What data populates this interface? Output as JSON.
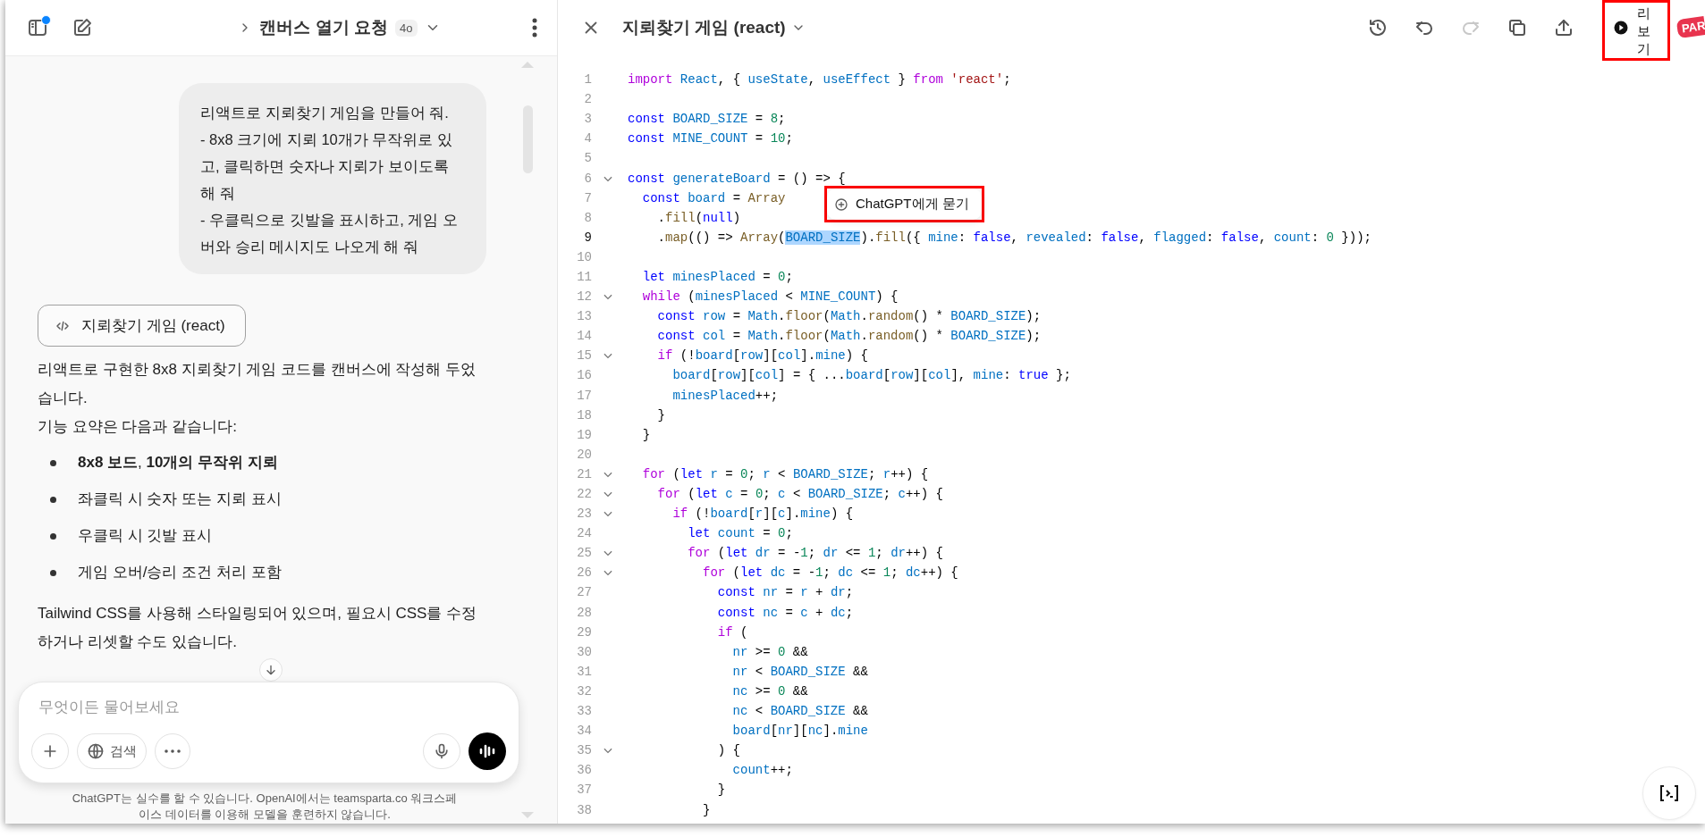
{
  "chat": {
    "header": {
      "title": "캔버스 열기 요청",
      "model": "4o",
      "unread": true
    },
    "user_message": "리액트로 지뢰찾기 게임을 만들어 줘.\n- 8x8 크기에 지뢰 10개가 무작위로 있고, 클릭하면 숫자나 지뢰가 보이도록 해 줘\n- 우클릭으로 깃발을 표시하고, 게임 오버와 승리 메시지도 나오게 해 줘",
    "canvas_chip": "지뢰찾기 게임 (react)",
    "intro": [
      "리액트로 구현한 8x8 지뢰찾기 게임 코드를 캔버스에 작성해 두었습니다.",
      "기능 요약은 다음과 같습니다:"
    ],
    "bullets": [
      "**8x8 보드**, **10개의 무작위 지뢰**",
      "좌클릭 시 숫자 또는 지뢰 표시",
      "우클릭 시 깃발 표시",
      "게임 오버/승리 조건 처리 포함"
    ],
    "outro": "Tailwind CSS를 사용해 스타일링되어 있으며, 필요시 CSS를 수정하거나 리셋할 수도 있습니다.",
    "composer": {
      "placeholder": "무엇이든 물어보세요",
      "search": "검색"
    },
    "disclaimer": "ChatGPT는 실수를 할 수 있습니다. OpenAI에서는 teamsparta.co 워크스페이스 데이터를 이용해 모델을 훈련하지 않습니다."
  },
  "canvas": {
    "title": "지뢰찾기 게임 (react)",
    "toolbar": [
      {
        "kind": "history",
        "disabled": false
      },
      {
        "kind": "undo",
        "disabled": false
      },
      {
        "kind": "redo",
        "disabled": true
      },
      {
        "kind": "copy",
        "disabled": false
      },
      {
        "kind": "share",
        "disabled": false
      }
    ],
    "preview": {
      "label": "리보기",
      "highlighted": true
    },
    "logo": "PAR",
    "ask_popup": {
      "label": "ChatGPT에게 묻기",
      "highlighted": true
    },
    "lines": [
      {
        "number": "1",
        "foldable": false,
        "current": false,
        "tokens": [
          {
            "kind": "ctl",
            "text": "import"
          },
          {
            "kind": "var",
            "text": " React"
          },
          {
            "kind": "p",
            "text": ", { "
          },
          {
            "kind": "var",
            "text": "useState"
          },
          {
            "kind": "p",
            "text": ", "
          },
          {
            "kind": "var",
            "text": "useEffect"
          },
          {
            "kind": "p",
            "text": " } "
          },
          {
            "kind": "ctl",
            "text": "from"
          },
          {
            "kind": "str",
            "text": " 'react'"
          },
          {
            "kind": "p",
            "text": ";"
          }
        ]
      },
      {
        "number": "2",
        "foldable": false,
        "current": false
      },
      {
        "number": "3",
        "foldable": false,
        "current": false,
        "tokens": [
          {
            "kind": "kw",
            "text": "const"
          },
          {
            "kind": "var",
            "text": " BOARD_SIZE"
          },
          {
            "kind": "p",
            "text": " = "
          },
          {
            "kind": "num",
            "text": "8"
          },
          {
            "kind": "p",
            "text": ";"
          }
        ]
      },
      {
        "number": "4",
        "foldable": false,
        "current": false,
        "tokens": [
          {
            "kind": "kw",
            "text": "const"
          },
          {
            "kind": "var",
            "text": " MINE_COUNT"
          },
          {
            "kind": "p",
            "text": " = "
          },
          {
            "kind": "num",
            "text": "10"
          },
          {
            "kind": "p",
            "text": ";"
          }
        ]
      },
      {
        "number": "5",
        "foldable": false,
        "current": false
      },
      {
        "number": "6",
        "foldable": true,
        "current": false,
        "tokens": [
          {
            "kind": "kw",
            "text": "const"
          },
          {
            "kind": "var",
            "text": " generateBoard"
          },
          {
            "kind": "p",
            "text": " = () => {"
          }
        ]
      },
      {
        "number": "7",
        "foldable": false,
        "current": false,
        "tokens": [
          {
            "kind": "kw",
            "text": "  const"
          },
          {
            "kind": "var",
            "text": " board"
          },
          {
            "kind": "p",
            "text": " = "
          },
          {
            "kind": "fn",
            "text": "Array"
          }
        ]
      },
      {
        "number": "8",
        "foldable": false,
        "current": false,
        "tokens": [
          {
            "kind": "p",
            "text": "    ."
          },
          {
            "kind": "fn",
            "text": "fill"
          },
          {
            "kind": "p",
            "text": "("
          },
          {
            "kind": "kw",
            "text": "null"
          },
          {
            "kind": "p",
            "text": ")"
          }
        ]
      },
      {
        "number": "9",
        "foldable": false,
        "current": true,
        "tokens": [
          {
            "kind": "p",
            "text": "    ."
          },
          {
            "kind": "fn",
            "text": "map"
          },
          {
            "kind": "p",
            "text": "(() => "
          },
          {
            "kind": "fn",
            "text": "Array"
          },
          {
            "kind": "p",
            "text": "("
          },
          {
            "kind": "sel",
            "text": "BOARD_SIZE"
          },
          {
            "kind": "p",
            "text": ")."
          },
          {
            "kind": "fn",
            "text": "fill"
          },
          {
            "kind": "p",
            "text": "({ "
          },
          {
            "kind": "var",
            "text": "mine"
          },
          {
            "kind": "p",
            "text": ": "
          },
          {
            "kind": "kw",
            "text": "false"
          },
          {
            "kind": "p",
            "text": ", "
          },
          {
            "kind": "var",
            "text": "revealed"
          },
          {
            "kind": "p",
            "text": ": "
          },
          {
            "kind": "kw",
            "text": "false"
          },
          {
            "kind": "p",
            "text": ", "
          },
          {
            "kind": "var",
            "text": "flagged"
          },
          {
            "kind": "p",
            "text": ": "
          },
          {
            "kind": "kw",
            "text": "false"
          },
          {
            "kind": "p",
            "text": ", "
          },
          {
            "kind": "var",
            "text": "count"
          },
          {
            "kind": "p",
            "text": ": "
          },
          {
            "kind": "num",
            "text": "0"
          },
          {
            "kind": "p",
            "text": " }));"
          }
        ]
      },
      {
        "number": "10",
        "foldable": false,
        "current": false
      },
      {
        "number": "11",
        "foldable": false,
        "current": false,
        "tokens": [
          {
            "kind": "kw",
            "text": "  let"
          },
          {
            "kind": "var",
            "text": " minesPlaced"
          },
          {
            "kind": "p",
            "text": " = "
          },
          {
            "kind": "num",
            "text": "0"
          },
          {
            "kind": "p",
            "text": ";"
          }
        ]
      },
      {
        "number": "12",
        "foldable": true,
        "current": false,
        "tokens": [
          {
            "kind": "ctl",
            "text": "  while"
          },
          {
            "kind": "p",
            "text": " ("
          },
          {
            "kind": "var",
            "text": "minesPlaced"
          },
          {
            "kind": "p",
            "text": " < "
          },
          {
            "kind": "var",
            "text": "MINE_COUNT"
          },
          {
            "kind": "p",
            "text": ") {"
          }
        ]
      },
      {
        "number": "13",
        "foldable": false,
        "current": false,
        "tokens": [
          {
            "kind": "kw",
            "text": "    const"
          },
          {
            "kind": "var",
            "text": " row"
          },
          {
            "kind": "p",
            "text": " = "
          },
          {
            "kind": "var",
            "text": "Math"
          },
          {
            "kind": "p",
            "text": "."
          },
          {
            "kind": "fn",
            "text": "floor"
          },
          {
            "kind": "p",
            "text": "("
          },
          {
            "kind": "var",
            "text": "Math"
          },
          {
            "kind": "p",
            "text": "."
          },
          {
            "kind": "fn",
            "text": "random"
          },
          {
            "kind": "p",
            "text": "() * "
          },
          {
            "kind": "var",
            "text": "BOARD_SIZE"
          },
          {
            "kind": "p",
            "text": ");"
          }
        ]
      },
      {
        "number": "14",
        "foldable": false,
        "current": false,
        "tokens": [
          {
            "kind": "kw",
            "text": "    const"
          },
          {
            "kind": "var",
            "text": " col"
          },
          {
            "kind": "p",
            "text": " = "
          },
          {
            "kind": "var",
            "text": "Math"
          },
          {
            "kind": "p",
            "text": "."
          },
          {
            "kind": "fn",
            "text": "floor"
          },
          {
            "kind": "p",
            "text": "("
          },
          {
            "kind": "var",
            "text": "Math"
          },
          {
            "kind": "p",
            "text": "."
          },
          {
            "kind": "fn",
            "text": "random"
          },
          {
            "kind": "p",
            "text": "() * "
          },
          {
            "kind": "var",
            "text": "BOARD_SIZE"
          },
          {
            "kind": "p",
            "text": ");"
          }
        ]
      },
      {
        "number": "15",
        "foldable": true,
        "current": false,
        "tokens": [
          {
            "kind": "ctl",
            "text": "    if"
          },
          {
            "kind": "p",
            "text": " (!"
          },
          {
            "kind": "var",
            "text": "board"
          },
          {
            "kind": "p",
            "text": "["
          },
          {
            "kind": "var",
            "text": "row"
          },
          {
            "kind": "p",
            "text": "]["
          },
          {
            "kind": "var",
            "text": "col"
          },
          {
            "kind": "p",
            "text": "]."
          },
          {
            "kind": "var",
            "text": "mine"
          },
          {
            "kind": "p",
            "text": ") {"
          }
        ]
      },
      {
        "number": "16",
        "foldable": false,
        "current": false,
        "tokens": [
          {
            "kind": "var",
            "text": "      board"
          },
          {
            "kind": "p",
            "text": "["
          },
          {
            "kind": "var",
            "text": "row"
          },
          {
            "kind": "p",
            "text": "]["
          },
          {
            "kind": "var",
            "text": "col"
          },
          {
            "kind": "p",
            "text": "] = { ..."
          },
          {
            "kind": "var",
            "text": "board"
          },
          {
            "kind": "p",
            "text": "["
          },
          {
            "kind": "var",
            "text": "row"
          },
          {
            "kind": "p",
            "text": "]["
          },
          {
            "kind": "var",
            "text": "col"
          },
          {
            "kind": "p",
            "text": "], "
          },
          {
            "kind": "var",
            "text": "mine"
          },
          {
            "kind": "p",
            "text": ": "
          },
          {
            "kind": "kw",
            "text": "true"
          },
          {
            "kind": "p",
            "text": " };"
          }
        ]
      },
      {
        "number": "17",
        "foldable": false,
        "current": false,
        "tokens": [
          {
            "kind": "var",
            "text": "      minesPlaced"
          },
          {
            "kind": "p",
            "text": "++;"
          }
        ]
      },
      {
        "number": "18",
        "foldable": false,
        "current": false,
        "tokens": [
          {
            "kind": "p",
            "text": "    }"
          }
        ]
      },
      {
        "number": "19",
        "foldable": false,
        "current": false,
        "tokens": [
          {
            "kind": "p",
            "text": "  }"
          }
        ]
      },
      {
        "number": "20",
        "foldable": false,
        "current": false
      },
      {
        "number": "21",
        "foldable": true,
        "current": false,
        "tokens": [
          {
            "kind": "ctl",
            "text": "  for"
          },
          {
            "kind": "p",
            "text": " ("
          },
          {
            "kind": "kw",
            "text": "let"
          },
          {
            "kind": "var",
            "text": " r"
          },
          {
            "kind": "p",
            "text": " = "
          },
          {
            "kind": "num",
            "text": "0"
          },
          {
            "kind": "p",
            "text": "; "
          },
          {
            "kind": "var",
            "text": "r"
          },
          {
            "kind": "p",
            "text": " < "
          },
          {
            "kind": "var",
            "text": "BOARD_SIZE"
          },
          {
            "kind": "p",
            "text": "; "
          },
          {
            "kind": "var",
            "text": "r"
          },
          {
            "kind": "p",
            "text": "++) {"
          }
        ]
      },
      {
        "number": "22",
        "foldable": true,
        "current": false,
        "tokens": [
          {
            "kind": "ctl",
            "text": "    for"
          },
          {
            "kind": "p",
            "text": " ("
          },
          {
            "kind": "kw",
            "text": "let"
          },
          {
            "kind": "var",
            "text": " c"
          },
          {
            "kind": "p",
            "text": " = "
          },
          {
            "kind": "num",
            "text": "0"
          },
          {
            "kind": "p",
            "text": "; "
          },
          {
            "kind": "var",
            "text": "c"
          },
          {
            "kind": "p",
            "text": " < "
          },
          {
            "kind": "var",
            "text": "BOARD_SIZE"
          },
          {
            "kind": "p",
            "text": "; "
          },
          {
            "kind": "var",
            "text": "c"
          },
          {
            "kind": "p",
            "text": "++) {"
          }
        ]
      },
      {
        "number": "23",
        "foldable": true,
        "current": false,
        "tokens": [
          {
            "kind": "ctl",
            "text": "      if"
          },
          {
            "kind": "p",
            "text": " (!"
          },
          {
            "kind": "var",
            "text": "board"
          },
          {
            "kind": "p",
            "text": "["
          },
          {
            "kind": "var",
            "text": "r"
          },
          {
            "kind": "p",
            "text": "]["
          },
          {
            "kind": "var",
            "text": "c"
          },
          {
            "kind": "p",
            "text": "]."
          },
          {
            "kind": "var",
            "text": "mine"
          },
          {
            "kind": "p",
            "text": ") {"
          }
        ]
      },
      {
        "number": "24",
        "foldable": false,
        "current": false,
        "tokens": [
          {
            "kind": "kw",
            "text": "        let"
          },
          {
            "kind": "var",
            "text": " count"
          },
          {
            "kind": "p",
            "text": " = "
          },
          {
            "kind": "num",
            "text": "0"
          },
          {
            "kind": "p",
            "text": ";"
          }
        ]
      },
      {
        "number": "25",
        "foldable": true,
        "current": false,
        "tokens": [
          {
            "kind": "ctl",
            "text": "        for"
          },
          {
            "kind": "p",
            "text": " ("
          },
          {
            "kind": "kw",
            "text": "let"
          },
          {
            "kind": "var",
            "text": " dr"
          },
          {
            "kind": "p",
            "text": " = -"
          },
          {
            "kind": "num",
            "text": "1"
          },
          {
            "kind": "p",
            "text": "; "
          },
          {
            "kind": "var",
            "text": "dr"
          },
          {
            "kind": "p",
            "text": " <= "
          },
          {
            "kind": "num",
            "text": "1"
          },
          {
            "kind": "p",
            "text": "; "
          },
          {
            "kind": "var",
            "text": "dr"
          },
          {
            "kind": "p",
            "text": "++) {"
          }
        ]
      },
      {
        "number": "26",
        "foldable": true,
        "current": false,
        "tokens": [
          {
            "kind": "ctl",
            "text": "          for"
          },
          {
            "kind": "p",
            "text": " ("
          },
          {
            "kind": "kw",
            "text": "let"
          },
          {
            "kind": "var",
            "text": " dc"
          },
          {
            "kind": "p",
            "text": " = -"
          },
          {
            "kind": "num",
            "text": "1"
          },
          {
            "kind": "p",
            "text": "; "
          },
          {
            "kind": "var",
            "text": "dc"
          },
          {
            "kind": "p",
            "text": " <= "
          },
          {
            "kind": "num",
            "text": "1"
          },
          {
            "kind": "p",
            "text": "; "
          },
          {
            "kind": "var",
            "text": "dc"
          },
          {
            "kind": "p",
            "text": "++) {"
          }
        ]
      },
      {
        "number": "27",
        "foldable": false,
        "current": false,
        "tokens": [
          {
            "kind": "kw",
            "text": "            const"
          },
          {
            "kind": "var",
            "text": " nr"
          },
          {
            "kind": "p",
            "text": " = "
          },
          {
            "kind": "var",
            "text": "r"
          },
          {
            "kind": "p",
            "text": " + "
          },
          {
            "kind": "var",
            "text": "dr"
          },
          {
            "kind": "p",
            "text": ";"
          }
        ]
      },
      {
        "number": "28",
        "foldable": false,
        "current": false,
        "tokens": [
          {
            "kind": "kw",
            "text": "            const"
          },
          {
            "kind": "var",
            "text": " nc"
          },
          {
            "kind": "p",
            "text": " = "
          },
          {
            "kind": "var",
            "text": "c"
          },
          {
            "kind": "p",
            "text": " + "
          },
          {
            "kind": "var",
            "text": "dc"
          },
          {
            "kind": "p",
            "text": ";"
          }
        ]
      },
      {
        "number": "29",
        "foldable": false,
        "current": false,
        "tokens": [
          {
            "kind": "ctl",
            "text": "            if"
          },
          {
            "kind": "p",
            "text": " ("
          }
        ]
      },
      {
        "number": "30",
        "foldable": false,
        "current": false,
        "tokens": [
          {
            "kind": "var",
            "text": "              nr"
          },
          {
            "kind": "p",
            "text": " >= "
          },
          {
            "kind": "num",
            "text": "0"
          },
          {
            "kind": "p",
            "text": " &&"
          }
        ]
      },
      {
        "number": "31",
        "foldable": false,
        "current": false,
        "tokens": [
          {
            "kind": "var",
            "text": "              nr"
          },
          {
            "kind": "p",
            "text": " < "
          },
          {
            "kind": "var",
            "text": "BOARD_SIZE"
          },
          {
            "kind": "p",
            "text": " &&"
          }
        ]
      },
      {
        "number": "32",
        "foldable": false,
        "current": false,
        "tokens": [
          {
            "kind": "var",
            "text": "              nc"
          },
          {
            "kind": "p",
            "text": " >= "
          },
          {
            "kind": "num",
            "text": "0"
          },
          {
            "kind": "p",
            "text": " &&"
          }
        ]
      },
      {
        "number": "33",
        "foldable": false,
        "current": false,
        "tokens": [
          {
            "kind": "var",
            "text": "              nc"
          },
          {
            "kind": "p",
            "text": " < "
          },
          {
            "kind": "var",
            "text": "BOARD_SIZE"
          },
          {
            "kind": "p",
            "text": " &&"
          }
        ]
      },
      {
        "number": "34",
        "foldable": false,
        "current": false,
        "tokens": [
          {
            "kind": "var",
            "text": "              board"
          },
          {
            "kind": "p",
            "text": "["
          },
          {
            "kind": "var",
            "text": "nr"
          },
          {
            "kind": "p",
            "text": "]["
          },
          {
            "kind": "var",
            "text": "nc"
          },
          {
            "kind": "p",
            "text": "]."
          },
          {
            "kind": "var",
            "text": "mine"
          }
        ]
      },
      {
        "number": "35",
        "foldable": true,
        "current": false,
        "tokens": [
          {
            "kind": "p",
            "text": "            ) {"
          }
        ]
      },
      {
        "number": "36",
        "foldable": false,
        "current": false,
        "tokens": [
          {
            "kind": "var",
            "text": "              count"
          },
          {
            "kind": "p",
            "text": "++;"
          }
        ]
      },
      {
        "number": "37",
        "foldable": false,
        "current": false,
        "tokens": [
          {
            "kind": "p",
            "text": "            }"
          }
        ]
      },
      {
        "number": "38",
        "foldable": false,
        "current": false,
        "tokens": [
          {
            "kind": "p",
            "text": "          }"
          }
        ]
      }
    ]
  }
}
